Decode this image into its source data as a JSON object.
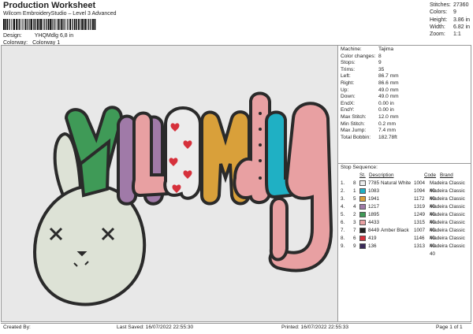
{
  "header": {
    "title": "Production Worksheet",
    "subtitle": "Wilcom EmbroideryStudio – Level 3 Advanced",
    "design_label": "Design:",
    "design_value": "YHQMdlg 6,8 in",
    "colorway_label": "Colorway:",
    "colorway_value": "Colorway 1"
  },
  "stats": [
    {
      "k": "Stitches:",
      "v": "27360"
    },
    {
      "k": "Colors:",
      "v": "9"
    },
    {
      "k": "Height:",
      "v": "3.86 in"
    },
    {
      "k": "Width:",
      "v": "6.82 in"
    },
    {
      "k": "Zoom:",
      "v": "1:1"
    }
  ],
  "design": {
    "text": "YHLQMdlg",
    "colors": {
      "bg": "#e8e8e8",
      "Y": "#3f9a57",
      "H": "#a07aa8",
      "L": "#e8a0a2",
      "Q": "#ececec",
      "M": "#d9a03a",
      "d": "#e8a0a2",
      "l": "#1fb0c4",
      "g": "#e8a0a2",
      "outline": "#2a2a2a",
      "hearts": "#d6303b",
      "bunny": "#dde2d6"
    }
  },
  "info": [
    {
      "k": "Machine:",
      "v": "Tajima"
    },
    {
      "k": "Color changes:",
      "v": "8"
    },
    {
      "k": "Stops:",
      "v": "9"
    },
    {
      "k": "Trims:",
      "v": "35"
    },
    {
      "k": "Left:",
      "v": "86.7 mm"
    },
    {
      "k": "Right:",
      "v": "86.6 mm"
    },
    {
      "k": "Up:",
      "v": "49.0 mm"
    },
    {
      "k": "Down:",
      "v": "49.0 mm"
    },
    {
      "k": "EndX:",
      "v": "0.00 in"
    },
    {
      "k": "EndY:",
      "v": "0.00 in"
    },
    {
      "k": "Max Stitch:",
      "v": "12.0 mm"
    },
    {
      "k": "Min Stitch:",
      "v": "0.2 mm"
    },
    {
      "k": "Max Jump:",
      "v": "7.4 mm"
    },
    {
      "k": "Total Bobbin:",
      "v": "182.78ft"
    }
  ],
  "sequence": {
    "title": "Stop Sequence:",
    "headers": {
      "st": "St.",
      "desc": "Description",
      "code": "Code",
      "brand": "Brand"
    },
    "rows": [
      {
        "a": "1.",
        "b": "8",
        "color": "#ececec",
        "code": "7785",
        "name": "Natural White",
        "num": "1004",
        "brand": "Madeira Classic 40"
      },
      {
        "a": "2.",
        "b": "1",
        "color": "#1fb0c4",
        "code": "1083",
        "name": "",
        "num": "1094",
        "brand": "Madeira Classic 40"
      },
      {
        "a": "3.",
        "b": "5",
        "color": "#d9a03a",
        "code": "1941",
        "name": "",
        "num": "1172",
        "brand": "Madeira Classic 40"
      },
      {
        "a": "4.",
        "b": "4",
        "color": "#a07aa8",
        "code": "1217",
        "name": "",
        "num": "1319",
        "brand": "Madeira Classic 40"
      },
      {
        "a": "5.",
        "b": "2",
        "color": "#3f9a57",
        "code": "1895",
        "name": "",
        "num": "1249",
        "brand": "Madeira Classic 40"
      },
      {
        "a": "6.",
        "b": "3",
        "color": "#e8a0a2",
        "code": "4433",
        "name": "",
        "num": "1315",
        "brand": "Madeira Classic 40"
      },
      {
        "a": "7.",
        "b": "7",
        "color": "#222222",
        "code": "8449",
        "name": "Amber Black",
        "num": "1007",
        "brand": "Madeira Classic 40"
      },
      {
        "a": "8.",
        "b": "6",
        "color": "#d6303b",
        "code": "419",
        "name": "",
        "num": "1146",
        "brand": "Madeira Classic 40"
      },
      {
        "a": "9.",
        "b": "9",
        "color": "#3a2a5a",
        "code": "136",
        "name": "",
        "num": "1313",
        "brand": "Madeira Classic 40"
      }
    ]
  },
  "footer": {
    "created": "Created By:",
    "saved": "Last Saved: 16/07/2022 22:55:30",
    "printed": "Printed: 16/07/2022 22:55:33",
    "page": "Page 1 of 1"
  }
}
